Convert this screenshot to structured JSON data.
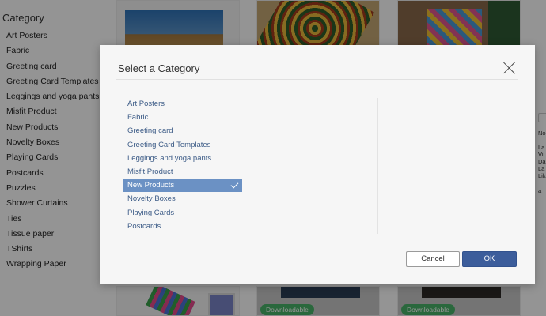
{
  "sidebar": {
    "heading": "Category",
    "items": [
      {
        "label": "Art Posters"
      },
      {
        "label": "Fabric"
      },
      {
        "label": "Greeting card"
      },
      {
        "label": "Greeting Card Templates"
      },
      {
        "label": "Leggings and yoga pants"
      },
      {
        "label": "Misfit Product"
      },
      {
        "label": "New Products"
      },
      {
        "label": "Novelty Boxes"
      },
      {
        "label": "Playing Cards"
      },
      {
        "label": "Postcards"
      },
      {
        "label": "Puzzles"
      },
      {
        "label": "Shower Curtains"
      },
      {
        "label": "Ties"
      },
      {
        "label": "Tissue paper"
      },
      {
        "label": "TShirts"
      },
      {
        "label": "Wrapping Paper"
      }
    ]
  },
  "product_grid": {
    "badges": [
      "Downloadable",
      "Downloadable"
    ]
  },
  "right_panel": {
    "labels": [
      "No",
      "La",
      "Vi",
      "Da",
      "La",
      "Lik",
      "a"
    ]
  },
  "modal": {
    "title": "Select a Category",
    "categories": [
      {
        "label": "Art Posters",
        "selected": false
      },
      {
        "label": "Fabric",
        "selected": false
      },
      {
        "label": "Greeting card",
        "selected": false
      },
      {
        "label": "Greeting Card Templates",
        "selected": false
      },
      {
        "label": "Leggings and yoga pants",
        "selected": false
      },
      {
        "label": "Misfit Product",
        "selected": false
      },
      {
        "label": "New Products",
        "selected": true
      },
      {
        "label": "Novelty Boxes",
        "selected": false
      },
      {
        "label": "Playing Cards",
        "selected": false
      },
      {
        "label": "Postcards",
        "selected": false
      }
    ],
    "cancel_label": "Cancel",
    "ok_label": "OK",
    "icons": {
      "close": "close-icon",
      "selected_marker": "check-icon"
    },
    "colors": {
      "selected_bg": "#6b91c4",
      "ok_bg": "#3c5d9b",
      "link_text": "#3d5c87"
    }
  }
}
